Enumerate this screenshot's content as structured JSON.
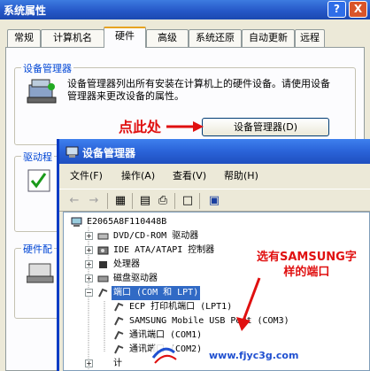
{
  "system_properties": {
    "title": "系统属性",
    "help_label": "?",
    "close_label": "X",
    "tabs": [
      "常规",
      "计算机名",
      "硬件",
      "高级",
      "系统还原",
      "自动更新",
      "远程"
    ],
    "active_tab": "硬件",
    "device_manager_group": {
      "label": "设备管理器",
      "description": "设备管理器列出所有安装在计算机上的硬件设备。请使用设备管理器来更改设备的属性。",
      "button_label": "设备管理器(D)"
    },
    "drivers_group_label": "驱动程",
    "hardware_profiles_label": "硬件配"
  },
  "device_manager": {
    "title": "设备管理器",
    "menu": [
      "文件(F)",
      "操作(A)",
      "查看(V)",
      "帮助(H)"
    ],
    "tree": {
      "root": "E2065A8F110448B",
      "items": [
        {
          "label": "DVD/CD-ROM 驱动器",
          "icon": "cdrom-icon"
        },
        {
          "label": "IDE ATA/ATAPI 控制器",
          "icon": "ide-icon"
        },
        {
          "label": "处理器",
          "icon": "processor-icon"
        },
        {
          "label": "磁盘驱动器",
          "icon": "disk-icon"
        },
        {
          "label": "端口 (COM 和 LPT)",
          "icon": "port-icon",
          "expanded": true,
          "selected": true
        }
      ],
      "ports": [
        "ECP 打印机端口 (LPT1)",
        "SAMSUNG Mobile USB Port (COM3)",
        "通讯端口 (COM1)",
        "通讯端口 (COM2)"
      ],
      "partial_item": "计"
    }
  },
  "annotations": {
    "click_here": "点此处",
    "select_samsung_line1": "选有SAMSUNG字",
    "select_samsung_line2": "样的端口"
  },
  "watermark": "www.fjyc3g.com",
  "colors": {
    "annotation_red": "#e01010",
    "xp_title_blue": "#2a63d8",
    "selection_blue": "#316ac5"
  }
}
